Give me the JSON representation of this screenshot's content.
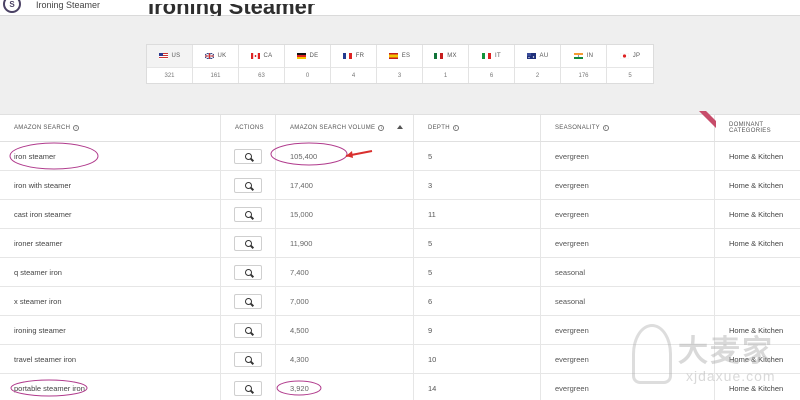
{
  "topbar": {
    "title": "Ironing Steamer"
  },
  "page": {
    "title": "Ironing Steamer"
  },
  "marketplaces": [
    {
      "code": "US",
      "count": "321",
      "flag": "us",
      "active": true
    },
    {
      "code": "UK",
      "count": "161",
      "flag": "uk",
      "active": false
    },
    {
      "code": "CA",
      "count": "63",
      "flag": "ca",
      "active": false
    },
    {
      "code": "DE",
      "count": "0",
      "flag": "de",
      "active": false
    },
    {
      "code": "FR",
      "count": "4",
      "flag": "fr",
      "active": false
    },
    {
      "code": "ES",
      "count": "3",
      "flag": "es",
      "active": false
    },
    {
      "code": "MX",
      "count": "1",
      "flag": "mx",
      "active": false
    },
    {
      "code": "IT",
      "count": "6",
      "flag": "it",
      "active": false
    },
    {
      "code": "AU",
      "count": "2",
      "flag": "au",
      "active": false
    },
    {
      "code": "IN",
      "count": "176",
      "flag": "in",
      "active": false
    },
    {
      "code": "JP",
      "count": "5",
      "flag": "jp",
      "active": false
    }
  ],
  "table": {
    "headers": {
      "search": "Amazon Search",
      "actions": "Actions",
      "volume": "Amazon Search Volume",
      "depth": "Depth",
      "seasonality": "Seasonality",
      "categories": "Dominant Categories"
    },
    "rows": [
      {
        "term": "iron steamer",
        "volume": "105,400",
        "depth": "5",
        "seasonality": "evergreen",
        "category": "Home & Kitchen"
      },
      {
        "term": "iron with steamer",
        "volume": "17,400",
        "depth": "3",
        "seasonality": "evergreen",
        "category": "Home & Kitchen"
      },
      {
        "term": "cast iron steamer",
        "volume": "15,000",
        "depth": "11",
        "seasonality": "evergreen",
        "category": "Home & Kitchen"
      },
      {
        "term": "ironer steamer",
        "volume": "11,900",
        "depth": "5",
        "seasonality": "evergreen",
        "category": "Home & Kitchen"
      },
      {
        "term": "q steamer iron",
        "volume": "7,400",
        "depth": "5",
        "seasonality": "seasonal",
        "category": ""
      },
      {
        "term": "x steamer iron",
        "volume": "7,000",
        "depth": "6",
        "seasonality": "seasonal",
        "category": ""
      },
      {
        "term": "ironing steamer",
        "volume": "4,500",
        "depth": "9",
        "seasonality": "evergreen",
        "category": "Home & Kitchen"
      },
      {
        "term": "travel steamer iron",
        "volume": "4,300",
        "depth": "10",
        "seasonality": "evergreen",
        "category": "Home & Kitchen"
      },
      {
        "term": "portable steamer iron",
        "volume": "3,920",
        "depth": "14",
        "seasonality": "evergreen",
        "category": "Home & Kitchen"
      }
    ]
  },
  "watermark": {
    "text": "大麦家",
    "url": "xjdaxue.com"
  },
  "colors": {
    "annotation": "#b03a8c",
    "ribbon": "#c74c6a",
    "brand": "#4b4265"
  }
}
